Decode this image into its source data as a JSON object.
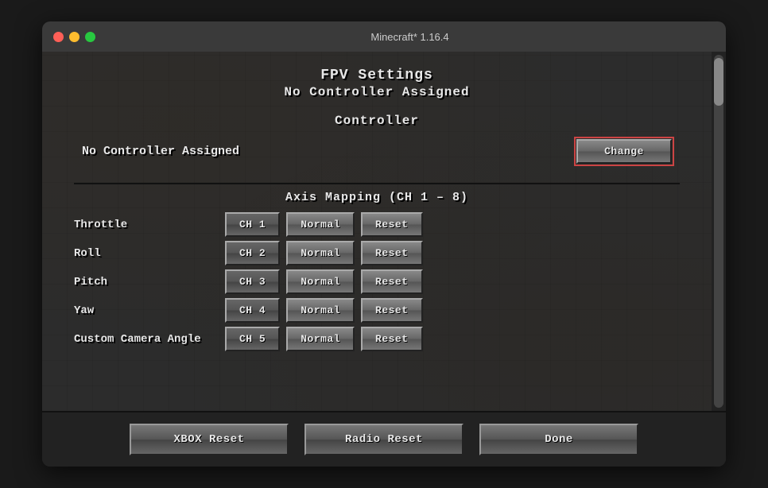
{
  "titlebar": {
    "title": "Minecraft* 1.16.4"
  },
  "header": {
    "title": "FPV Settings",
    "subtitle": "No Controller Assigned"
  },
  "controller_section": {
    "label": "Controller",
    "assigned_label": "No Controller Assigned",
    "change_button": "Change"
  },
  "axis_section": {
    "label": "Axis Mapping (CH 1 – 8)",
    "rows": [
      {
        "name": "Throttle",
        "ch": "CH 1",
        "normal": "Normal",
        "reset": "Reset"
      },
      {
        "name": "Roll",
        "ch": "CH 2",
        "normal": "Normal",
        "reset": "Reset"
      },
      {
        "name": "Pitch",
        "ch": "CH 3",
        "normal": "Normal",
        "reset": "Reset"
      },
      {
        "name": "Yaw",
        "ch": "CH 4",
        "normal": "Normal",
        "reset": "Reset"
      },
      {
        "name": "Custom Camera Angle",
        "ch": "CH 5",
        "normal": "Normal",
        "reset": "Reset"
      }
    ]
  },
  "bottom_buttons": {
    "xbox_reset": "XBOX Reset",
    "radio_reset": "Radio Reset",
    "done": "Done"
  },
  "traffic_lights": {
    "close": "close",
    "minimize": "minimize",
    "maximize": "maximize"
  }
}
